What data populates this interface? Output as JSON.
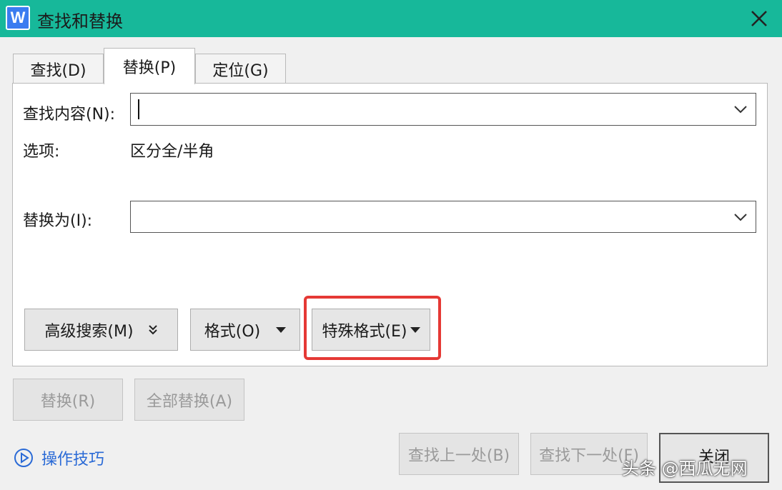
{
  "window": {
    "app_icon": "W",
    "title": "查找和替换",
    "close_icon": "close-icon"
  },
  "tabs": [
    {
      "label": "查找(D)",
      "active": false
    },
    {
      "label": "替换(P)",
      "active": true
    },
    {
      "label": "定位(G)",
      "active": false
    }
  ],
  "find": {
    "label": "查找内容(N):",
    "value": ""
  },
  "options": {
    "label": "选项:",
    "value": "区分全/半角"
  },
  "replace": {
    "label": "替换为(I):",
    "value": ""
  },
  "buttons": {
    "advanced_search": "高级搜索(M)",
    "format": "格式(O)",
    "special_format": "特殊格式(E)",
    "replace": "替换(R)",
    "replace_all": "全部替换(A)",
    "find_prev": "查找上一处(B)",
    "find_next": "查找下一处(F)",
    "close": "关闭"
  },
  "tips": {
    "label": "操作技巧",
    "icon": "play-circle-icon"
  },
  "watermark": "头条 @西瓜无网",
  "colors": {
    "titlebar": "#17b89a",
    "highlight": "#e53935",
    "link": "#2a6ad6"
  }
}
